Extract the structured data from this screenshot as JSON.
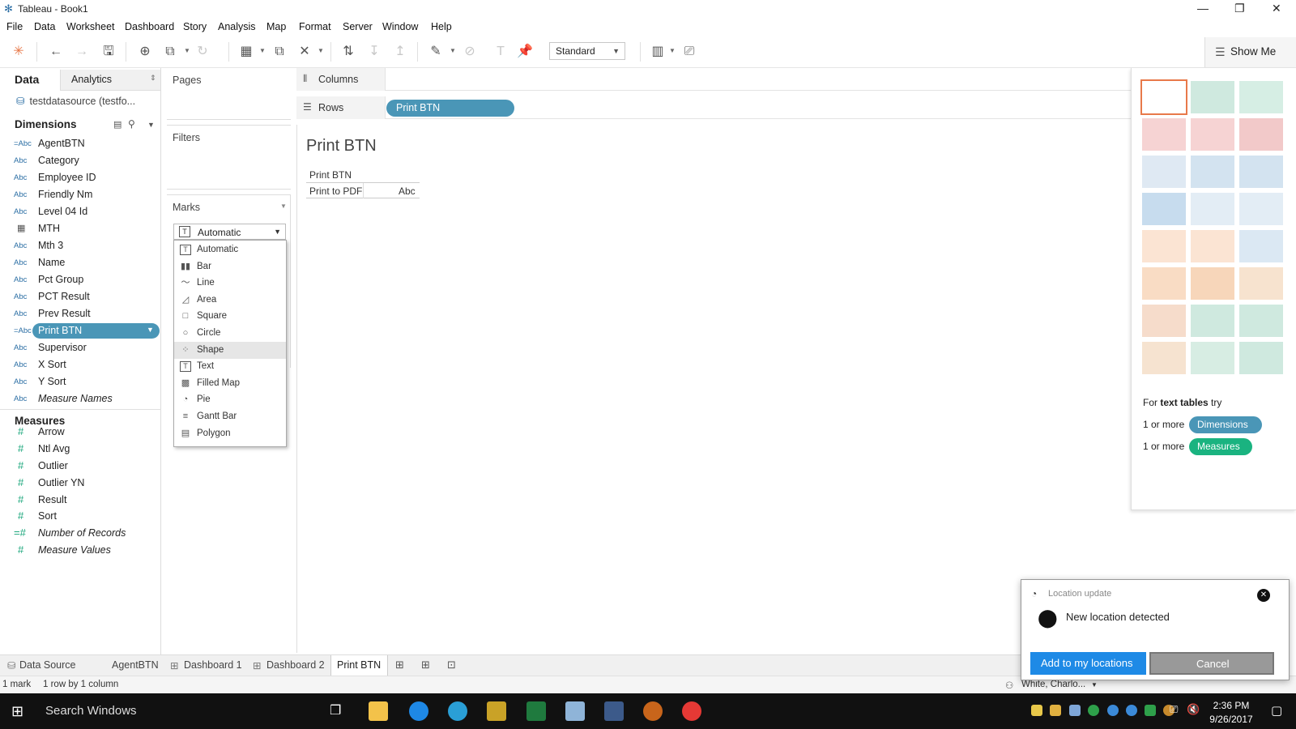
{
  "window": {
    "title": "Tableau - Book1",
    "controls": [
      "—",
      "❐",
      "✕"
    ]
  },
  "menu": [
    "File",
    "Data",
    "Worksheet",
    "Dashboard",
    "Story",
    "Analysis",
    "Map",
    "Format",
    "Server",
    "Window",
    "Help"
  ],
  "toolbar": {
    "fit_value": "Standard",
    "show_me_label": "Show Me"
  },
  "data_pane": {
    "tab_data": "Data",
    "tab_analytics": "Analytics",
    "datasource": "testdatasource (testfo...",
    "dimensions_title": "Dimensions",
    "dimensions": [
      {
        "type": "=Abc",
        "name": "AgentBTN"
      },
      {
        "type": "Abc",
        "name": "Category"
      },
      {
        "type": "Abc",
        "name": "Employee ID"
      },
      {
        "type": "Abc",
        "name": "Friendly Nm"
      },
      {
        "type": "Abc",
        "name": "Level 04 Id"
      },
      {
        "type": "cal",
        "name": "MTH"
      },
      {
        "type": "Abc",
        "name": "Mth 3"
      },
      {
        "type": "Abc",
        "name": "Name"
      },
      {
        "type": "Abc",
        "name": "Pct Group"
      },
      {
        "type": "Abc",
        "name": "PCT Result"
      },
      {
        "type": "Abc",
        "name": "Prev Result"
      },
      {
        "type": "=Abc",
        "name": "Print BTN"
      },
      {
        "type": "Abc",
        "name": "Supervisor"
      },
      {
        "type": "Abc",
        "name": "X Sort"
      },
      {
        "type": "Abc",
        "name": "Y Sort"
      },
      {
        "type": "Abc",
        "name": "Measure Names"
      }
    ],
    "measures_title": "Measures",
    "measures": [
      {
        "type": "#",
        "name": "Arrow"
      },
      {
        "type": "#",
        "name": "Ntl Avg"
      },
      {
        "type": "#",
        "name": "Outlier"
      },
      {
        "type": "#",
        "name": "Outlier YN"
      },
      {
        "type": "#",
        "name": "Result"
      },
      {
        "type": "#",
        "name": "Sort"
      },
      {
        "type": "=#",
        "name": "Number of Records"
      },
      {
        "type": "#",
        "name": "Measure Values"
      }
    ]
  },
  "cards": {
    "pages": "Pages",
    "filters": "Filters",
    "marks": "Marks",
    "mark_type": "Automatic",
    "mark_icon": "T",
    "mark_menu": [
      {
        "icon": "T",
        "label": "Automatic"
      },
      {
        "icon": "▮▮",
        "label": "Bar"
      },
      {
        "icon": "〜",
        "label": "Line"
      },
      {
        "icon": "◿",
        "label": "Area"
      },
      {
        "icon": "□",
        "label": "Square"
      },
      {
        "icon": "○",
        "label": "Circle"
      },
      {
        "icon": "⁘",
        "label": "Shape"
      },
      {
        "icon": "T",
        "label": "Text"
      },
      {
        "icon": "▩",
        "label": "Filled Map"
      },
      {
        "icon": "◔",
        "label": "Pie"
      },
      {
        "icon": "≡",
        "label": "Gantt Bar"
      },
      {
        "icon": "▤",
        "label": "Polygon"
      }
    ]
  },
  "shelves": {
    "columns": "Columns",
    "rows": "Rows",
    "rows_pill": "Print BTN"
  },
  "view": {
    "title": "Print BTN",
    "header": "Print BTN",
    "row_label": "Print to PDF",
    "row_value": "Abc"
  },
  "showme": {
    "hint_prefix": "For",
    "hint_bold": "text tables",
    "hint_suffix": "try",
    "req1_prefix": "1 or more",
    "req1_pill": "Dimensions",
    "req2_prefix": "1 or more",
    "req2_pill": "Measures",
    "colors": {
      "dimension": "#4a96b7",
      "measure": "#1ab380",
      "selected": "#e8794a"
    }
  },
  "sheet_tabs": [
    {
      "label": "Data Source",
      "icon": "datasource-icon"
    },
    {
      "label": "AgentBTN",
      "icon": ""
    },
    {
      "label": "Dashboard 1",
      "icon": "dashboard-icon"
    },
    {
      "label": "Dashboard 2",
      "icon": "dashboard-icon"
    },
    {
      "label": "Print BTN",
      "icon": ""
    }
  ],
  "status": {
    "marks": "1 mark",
    "dims": "1 row by 1 column",
    "user": "White, Charlo..."
  },
  "taskbar": {
    "search_placeholder": "Search Windows",
    "time": "2:36 PM",
    "date": "9/26/2017"
  },
  "toast": {
    "header": "Location update",
    "message": "New location detected",
    "primary": "Add to my locations",
    "secondary": "Cancel"
  }
}
